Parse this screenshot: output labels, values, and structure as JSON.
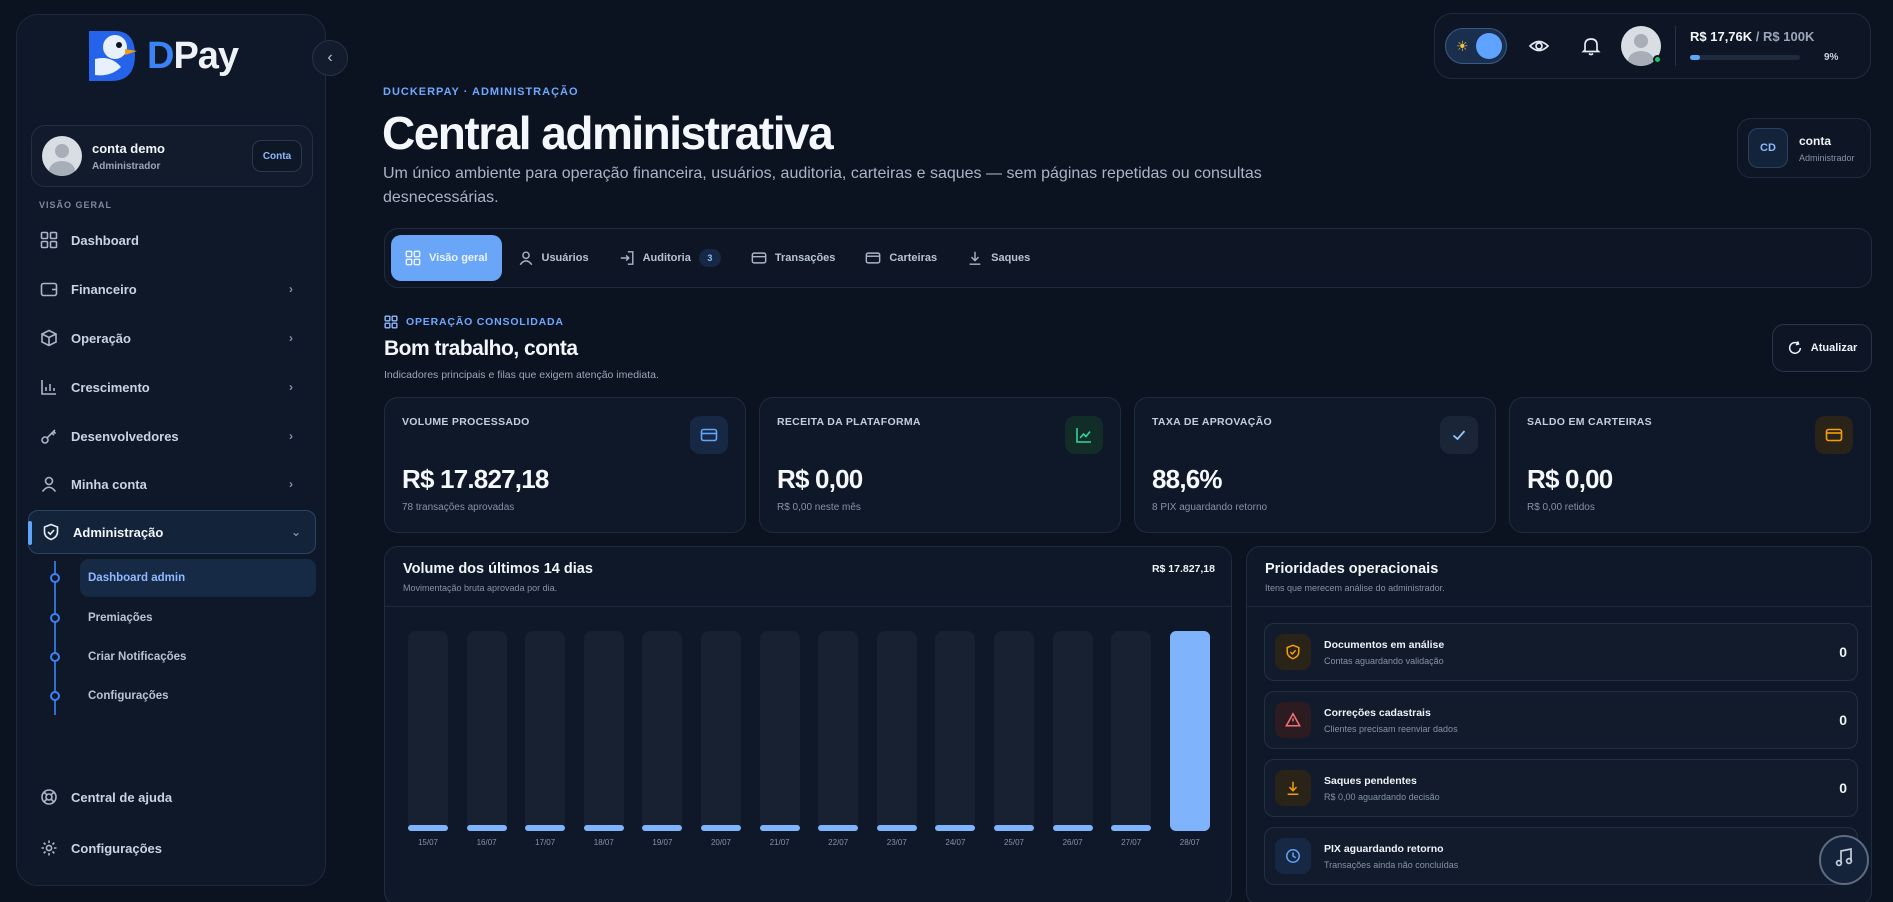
{
  "brand": {
    "letter": "D",
    "name": "Pay"
  },
  "user": {
    "name": "conta demo",
    "role": "Administrador",
    "account_button": "Conta"
  },
  "sidebar": {
    "section": "VISÃO GERAL",
    "items": [
      {
        "label": "Dashboard",
        "icon": "grid-icon"
      },
      {
        "label": "Financeiro",
        "icon": "wallet-icon"
      },
      {
        "label": "Operação",
        "icon": "box-icon"
      },
      {
        "label": "Crescimento",
        "icon": "bar-chart-icon"
      },
      {
        "label": "Desenvolvedores",
        "icon": "key-icon"
      },
      {
        "label": "Minha conta",
        "icon": "user-icon"
      },
      {
        "label": "Administração",
        "icon": "shield-icon"
      }
    ],
    "subitems": [
      {
        "label": "Dashboard admin"
      },
      {
        "label": "Premiações"
      },
      {
        "label": "Criar Notificações"
      },
      {
        "label": "Configurações"
      }
    ],
    "bottom": [
      {
        "label": "Central de ajuda",
        "icon": "lifebuoy-icon"
      },
      {
        "label": "Configurações",
        "icon": "gear-icon"
      }
    ]
  },
  "topbar": {
    "balance": "R$ 17,76K",
    "limit": "R$ 100K",
    "balance_separator": "/",
    "progress_percent_label": "9%",
    "progress_fraction": 0.09
  },
  "header": {
    "eyebrow": "DUCKERPAY · ADMINISTRAÇÃO",
    "title": "Central administrativa",
    "description": "Um único ambiente para operação financeira, usuários, auditoria, carteiras e saques — sem páginas repetidas ou consultas desnecessárias."
  },
  "account_card": {
    "initials": "CD",
    "name": "conta",
    "role": "Administrador"
  },
  "tabs": [
    {
      "label": "Visão geral",
      "icon": "grid-icon"
    },
    {
      "label": "Usuários",
      "icon": "user-icon"
    },
    {
      "label": "Auditoria",
      "icon": "login-icon",
      "badge": "3"
    },
    {
      "label": "Transações",
      "icon": "card-icon"
    },
    {
      "label": "Carteiras",
      "icon": "wallet-icon"
    },
    {
      "label": "Saques",
      "icon": "download-icon"
    }
  ],
  "section": {
    "label": "OPERAÇÃO CONSOLIDADA",
    "title": "Bom trabalho, conta",
    "subtitle": "Indicadores principais e filas que exigem atenção imediata.",
    "refresh_label": "Atualizar"
  },
  "kpis": [
    {
      "label": "VOLUME PROCESSADO",
      "value": "R$ 17.827,18",
      "foot": "78 transações aprovadas",
      "icon": "card-icon",
      "color": "#60a5fa"
    },
    {
      "label": "RECEITA DA PLATAFORMA",
      "value": "R$ 0,00",
      "foot": "R$ 0,00 neste mês",
      "icon": "trend-icon",
      "color": "#34d399"
    },
    {
      "label": "TAXA DE APROVAÇÃO",
      "value": "88,6%",
      "foot": "8 PIX aguardando retorno",
      "icon": "check-icon",
      "color": "#93c5fd"
    },
    {
      "label": "SALDO EM CARTEIRAS",
      "value": "R$ 0,00",
      "foot": "R$ 0,00 retidos",
      "icon": "wallet-icon",
      "color": "#f59e0b"
    }
  ],
  "volume_panel": {
    "title": "Volume dos últimos 14 dias",
    "subtitle": "Movimentação bruta aprovada por dia.",
    "total": "R$ 17.827,18"
  },
  "chart_data": {
    "type": "bar",
    "categories": [
      "15/07",
      "16/07",
      "17/07",
      "18/07",
      "19/07",
      "20/07",
      "21/07",
      "22/07",
      "23/07",
      "24/07",
      "25/07",
      "26/07",
      "27/07",
      "28/07"
    ],
    "values": [
      0,
      0,
      0,
      0,
      0,
      0,
      0,
      0,
      0,
      0,
      0,
      0,
      0,
      17827.18
    ],
    "title": "Volume dos últimos 14 dias"
  },
  "priorities": {
    "title": "Prioridades operacionais",
    "subtitle": "Itens que merecem análise do administrador.",
    "items": [
      {
        "title": "Documentos em análise",
        "subtitle": "Contas aguardando validação",
        "value": "0",
        "icon": "shield-icon",
        "color": "#f59e0b"
      },
      {
        "title": "Correções cadastrais",
        "subtitle": "Clientes precisam reenviar dados",
        "value": "0",
        "icon": "alert-icon",
        "color": "#f87171"
      },
      {
        "title": "Saques pendentes",
        "subtitle": "R$ 0,00 aguardando decisão",
        "value": "0",
        "icon": "download-icon",
        "color": "#f59e0b"
      },
      {
        "title": "PIX aguardando retorno",
        "subtitle": "Transações ainda não concluídas",
        "value": "",
        "icon": "clock-icon",
        "color": "#60a5fa"
      }
    ]
  }
}
